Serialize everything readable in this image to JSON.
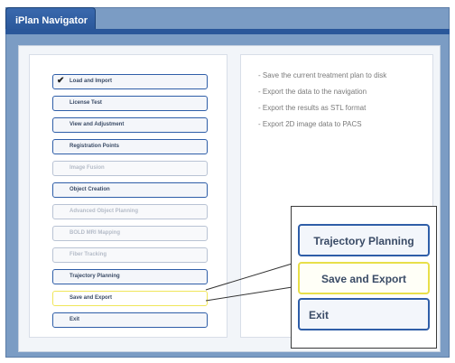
{
  "window": {
    "tab_label": "iPlan Navigator"
  },
  "description": {
    "lines": [
      "- Save the current treatment plan to disk",
      "- Export the data to the navigation",
      "- Export the results as STL format",
      "- Export 2D image data to PACS"
    ]
  },
  "nav": {
    "items": [
      {
        "label": "Load and Import",
        "state": "done",
        "check": "✔"
      },
      {
        "label": "License Test",
        "state": "enabled"
      },
      {
        "label": "View and Adjustment",
        "state": "enabled"
      },
      {
        "label": "Registration Points",
        "state": "enabled"
      },
      {
        "label": "Image Fusion",
        "state": "disabled"
      },
      {
        "label": "Object Creation",
        "state": "enabled"
      },
      {
        "label": "Advanced Object Planning",
        "state": "disabled"
      },
      {
        "label": "BOLD MRI Mapping",
        "state": "disabled"
      },
      {
        "label": "Fiber Tracking",
        "state": "disabled"
      },
      {
        "label": "Trajectory Planning",
        "state": "enabled"
      },
      {
        "label": "Save and Export",
        "state": "selected"
      },
      {
        "label": "Exit",
        "state": "enabled"
      }
    ]
  },
  "callout": {
    "trajectory_label": "Trajectory Planning",
    "save_export_label": "Save and Export",
    "exit_label": "Exit"
  },
  "colors": {
    "accent_blue": "#2f5ea8",
    "selected_yellow": "#f0e65a"
  }
}
